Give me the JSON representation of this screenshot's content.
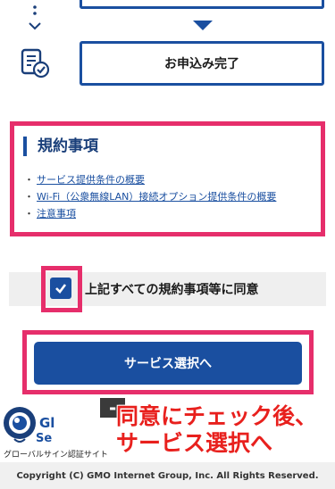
{
  "steps": {
    "current_step_label": "お申込み完了"
  },
  "terms": {
    "title": "規約事項",
    "bullet": "・",
    "links": [
      "サービス提供条件の概要",
      "Wi-Fi（公衆無線LAN）接続オプション提供条件の概要",
      "注意事項"
    ]
  },
  "agreement": {
    "label": "上記すべての規約事項等に同意",
    "checked": true
  },
  "submit": {
    "label": "サービス選択へ"
  },
  "seal": {
    "logo_text_top": "Gl",
    "logo_text_bottom": "Se",
    "caption": "グローバルサイン認証サイト"
  },
  "annotation": {
    "line1": "同意にチェック後、",
    "line2": "サービス選択へ"
  },
  "footer": {
    "copyright": "Copyright (C) GMO Internet Group, Inc. All Rights Reserved."
  },
  "colors": {
    "brand_blue": "#1a4fa0",
    "highlight_pink": "#e62e6b",
    "annotation_red": "#e8201d"
  }
}
